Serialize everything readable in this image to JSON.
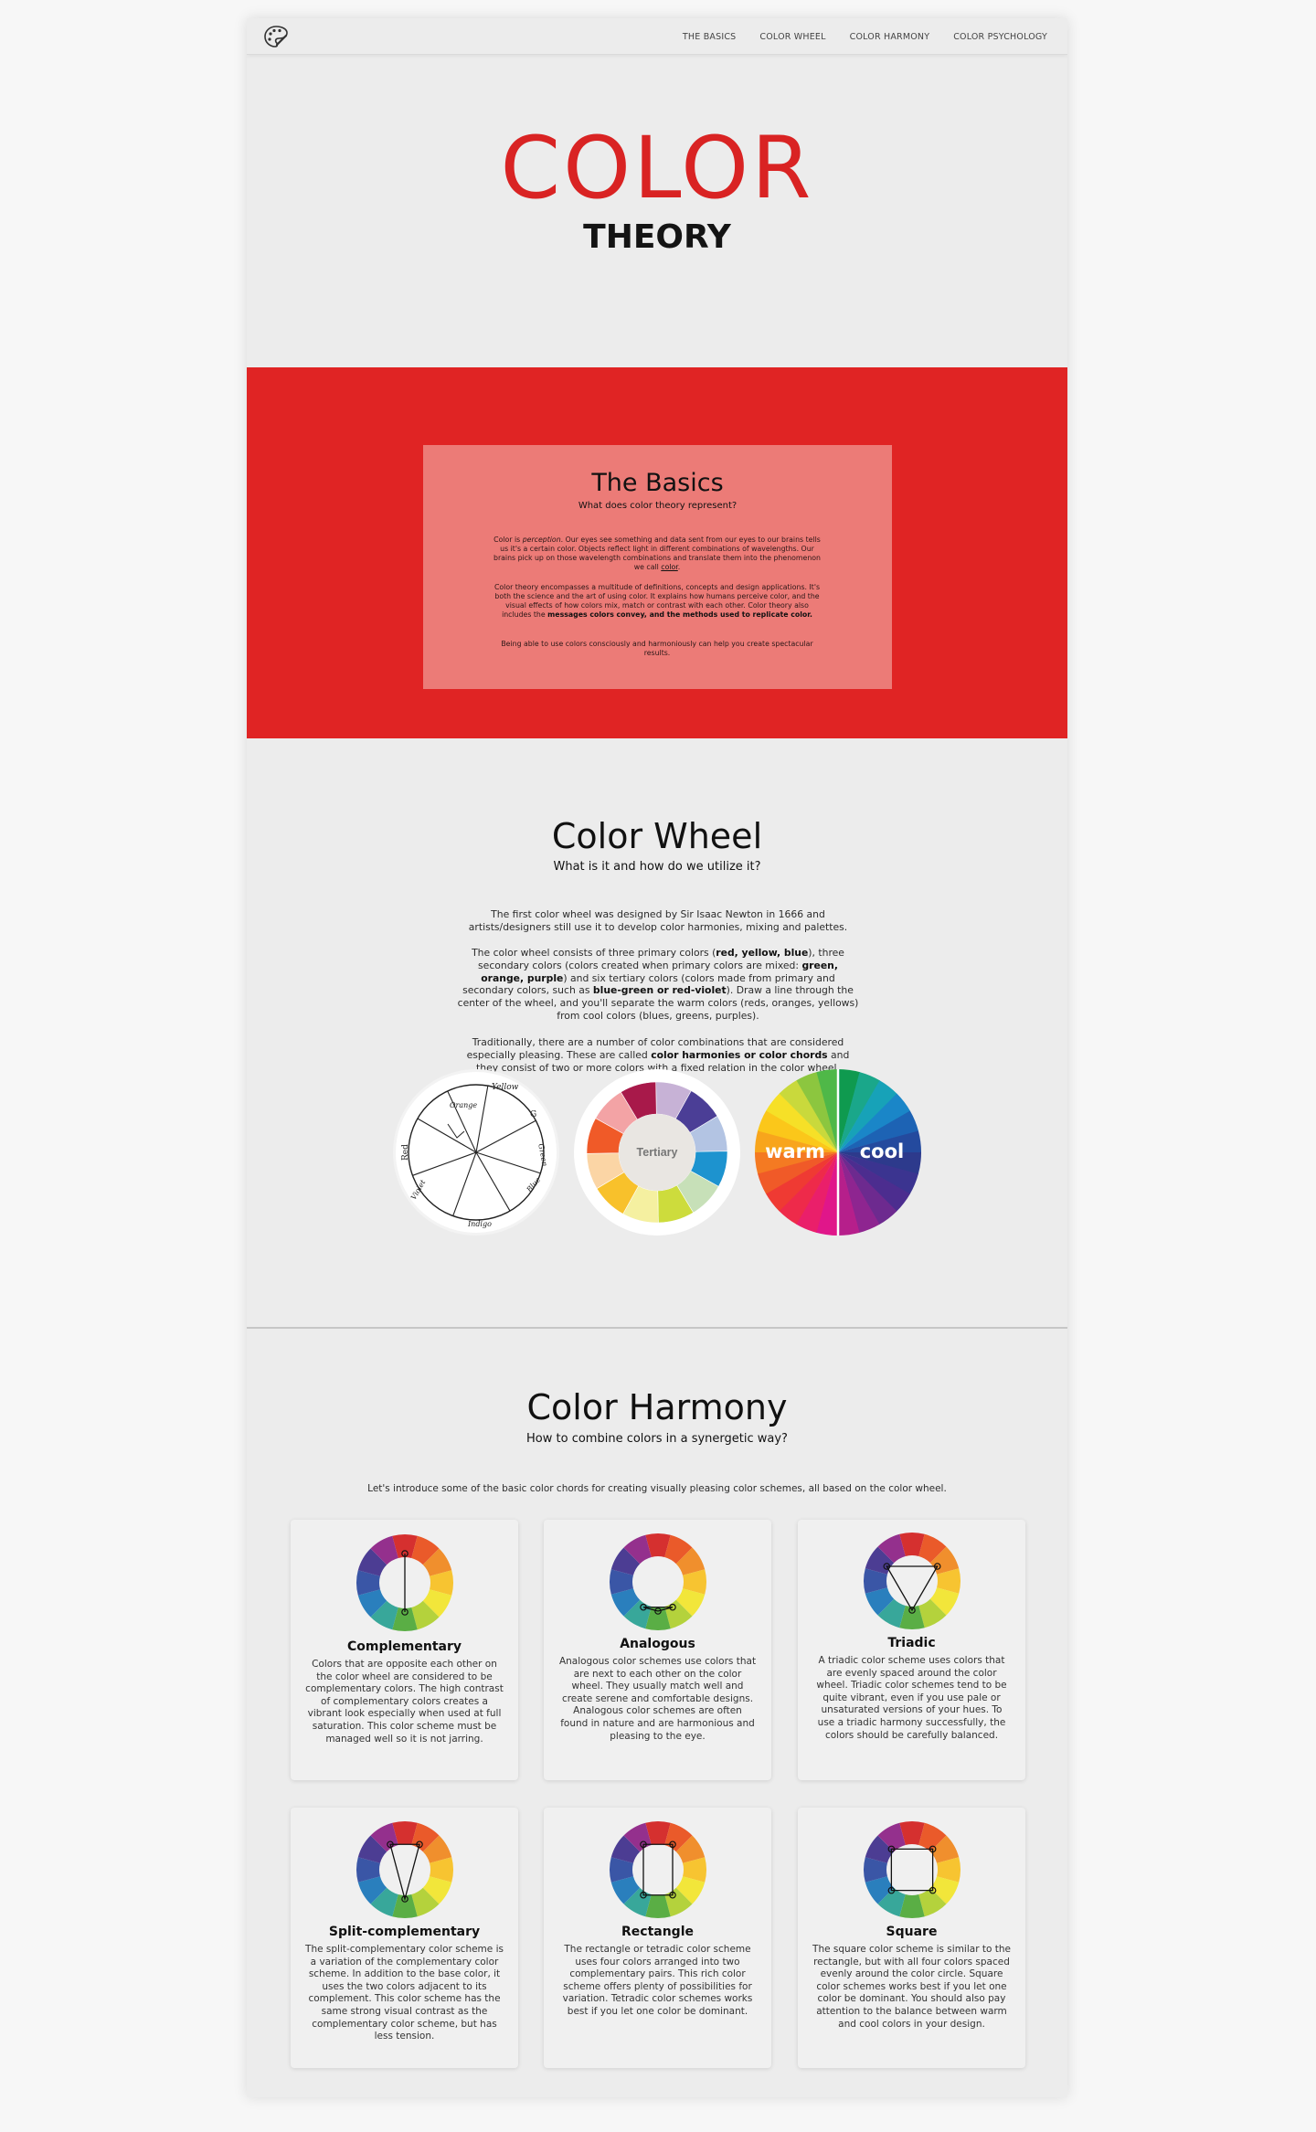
{
  "nav": {
    "logo_icon": "palette-icon",
    "links": [
      "THE BASICS",
      "COLOR WHEEL",
      "COLOR HARMONY",
      "COLOR PSYCHOLOGY"
    ]
  },
  "hero": {
    "title": "COLOR",
    "subtitle": "THEORY"
  },
  "basics": {
    "title": "The Basics",
    "subtitle": "What does color theory represent?",
    "p1_before": "Color is ",
    "p1_em": "perception",
    "p1_after": ". Our eyes see something and data sent from our eyes to our brains tells us it's a certain color. Objects reflect light in different combinations of wavelengths. Our brains pick up on those wavelength combinations and translate them into the phenomenon we call ",
    "p1_link": "color",
    "p1_end": ".",
    "p2_before": "Color theory encompasses a multitude of definitions, concepts and design applications. It's both the science and the art of using color. It explains how humans perceive color, and the visual effects of how colors mix, match or contrast with each other. Color theory also includes the ",
    "p2_bold": "messages colors convey, and the methods used to replicate color.",
    "p3": "Being able to use colors consciously and harmoniously can help you create spectacular results."
  },
  "wheel": {
    "title": "Color Wheel",
    "subtitle": "What is it and how do we utilize it?",
    "p1": "The first color wheel was designed by Sir Isaac Newton in 1666 and artists/designers still use it to develop color harmonies, mixing and palettes.",
    "p2_a": "The color wheel consists of three primary colors (",
    "p2_b1": "red, yellow, blue",
    "p2_c": "), three secondary colors (colors created when primary colors are mixed: ",
    "p2_b2": "green, orange, purple",
    "p2_d": ") and six tertiary colors (colors made from primary and secondary colors, such as ",
    "p2_b3": "blue-green or red-violet",
    "p2_e": "). Draw a line through the center of the wheel, and you'll separate the warm colors (reds, oranges, yellows) from cool colors (blues, greens, purples).",
    "p3_a": "Traditionally, there are a number of color combinations that are considered especially pleasing. These are called ",
    "p3_b": "color harmonies or color chords",
    "p3_c": " and they consist of two or more colors with a fixed relation in the color wheel.",
    "tertiary_label": "Tertiary",
    "warm_label": "warm",
    "cool_label": "cool",
    "newton_labels": [
      "Orange",
      "Yellow",
      "G",
      "Green",
      "Blue",
      "Indigo",
      "Violet",
      "Red"
    ]
  },
  "harmony": {
    "title": "Color Harmony",
    "subtitle": "How to combine colors in a synergetic way?",
    "intro": "Let's introduce some of the basic color chords for creating visually pleasing color schemes, all based on the color wheel.",
    "cards": [
      {
        "title": "Complementary",
        "icon": "complementary-wheel-icon",
        "text": "Colors that are opposite each other on the color wheel are considered to be complementary colors. The high contrast of complementary colors creates a vibrant look especially when used at full saturation. This color scheme must be managed well so it is not jarring."
      },
      {
        "title": "Analogous",
        "icon": "analogous-wheel-icon",
        "text": "Analogous color schemes use colors that are next to each other on the color wheel. They usually match well and create serene and comfortable designs. Analogous color schemes are often found in nature and are harmonious and pleasing to the eye."
      },
      {
        "title": "Triadic",
        "icon": "triadic-wheel-icon",
        "text": "A triadic color scheme uses colors that are evenly spaced around the color wheel. Triadic color schemes tend to be quite vibrant, even if you use pale or unsaturated versions of your hues. To use a triadic harmony successfully, the colors should be carefully balanced."
      },
      {
        "title": "Split-complementary",
        "icon": "split-complementary-wheel-icon",
        "text": "The split-complementary color scheme is a variation of the complementary color scheme. In addition to the base color, it uses the two colors adjacent to its complement. This color scheme has the same strong visual contrast as the complementary color scheme, but has less tension."
      },
      {
        "title": "Rectangle",
        "icon": "rectangle-wheel-icon",
        "text": "The rectangle or tetradic color scheme uses four colors arranged into two complementary pairs. This rich color scheme offers plenty of possibilities for variation. Tetradic color schemes works best if you let one color be dominant."
      },
      {
        "title": "Square",
        "icon": "square-wheel-icon",
        "text": "The square color scheme is similar to the rectangle, but with all four colors spaced evenly around the color circle. Square color schemes works best if you let one color be dominant. You should also pay attention to the balance between warm and cool colors in your design."
      }
    ]
  },
  "colors": {
    "accent_red": "#d92323",
    "section_red": "#e02424",
    "card_salmon": "#ec7b77",
    "page_bg": "#ececec",
    "wheel12": [
      "#d5302f",
      "#ea5a2a",
      "#f08f2d",
      "#f7c431",
      "#f2e63a",
      "#b4d23c",
      "#5aae45",
      "#38a79a",
      "#2a7fbd",
      "#3a56a6",
      "#4c3d93",
      "#94308d"
    ]
  }
}
